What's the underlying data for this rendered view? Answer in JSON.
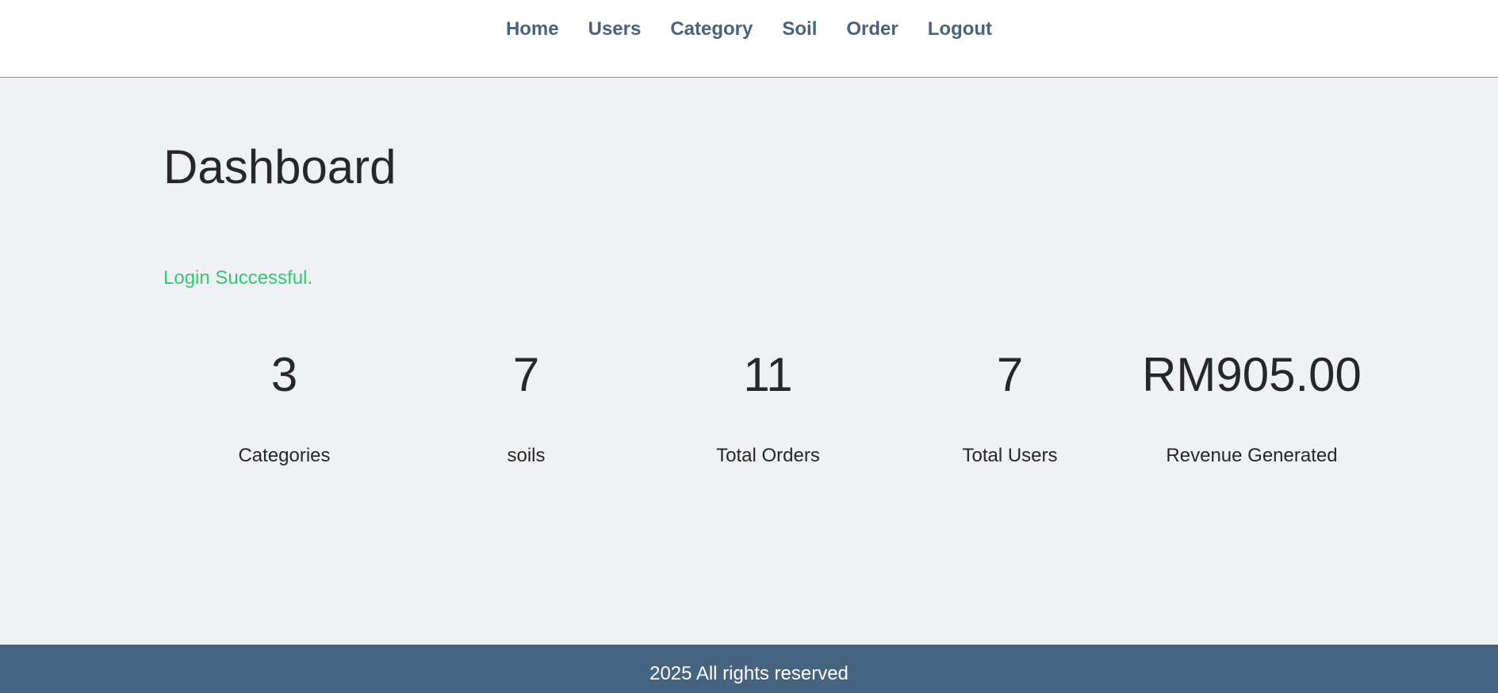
{
  "nav": {
    "items": [
      {
        "label": "Home"
      },
      {
        "label": "Users"
      },
      {
        "label": "Category"
      },
      {
        "label": "Soil"
      },
      {
        "label": "Order"
      },
      {
        "label": "Logout"
      }
    ]
  },
  "main": {
    "title": "Dashboard",
    "flash_message": "Login Successful.",
    "stats": [
      {
        "value": "3",
        "label": "Categories"
      },
      {
        "value": "7",
        "label": "soils"
      },
      {
        "value": "11",
        "label": "Total Orders"
      },
      {
        "value": "7",
        "label": "Total Users"
      },
      {
        "value": "RM905.00",
        "label": "Revenue Generated"
      }
    ]
  },
  "footer": {
    "text": "2025 All rights reserved"
  },
  "colors": {
    "nav_link": "#46637f",
    "success": "#2ecc71",
    "footer_bg": "#46637f",
    "page_bg": "#f0f1f5"
  }
}
